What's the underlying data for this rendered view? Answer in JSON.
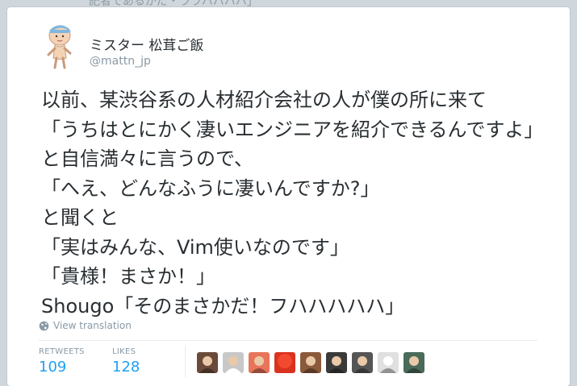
{
  "background": {
    "snippet": "記者であるがだ・ララハハハハ」"
  },
  "tweet": {
    "author": {
      "display_name": "ミスター 松茸ご飯",
      "username": "@mattn_jp"
    },
    "text_lines": [
      "以前、某渋谷系の人材紹介会社の人が僕の所に来て",
      "「うちはとにかく凄いエンジニアを紹介できるんですよ」",
      "と自信満々に言うので、",
      "「へえ、どんなふうに凄いんですか?」",
      "と聞くと",
      "「実はみんな、Vim使いなのです」",
      "「貴様！まさか！」",
      "Shougo「そのまさかだ！フハハハハハ」"
    ],
    "translate_label": "View translation",
    "stats": {
      "retweets_label": "RETWEETS",
      "retweets_value": "109",
      "likes_label": "LIKES",
      "likes_value": "128"
    },
    "liker_avatars": [
      {
        "icon": "liker-avatar-1",
        "color": "#6b4a3a"
      },
      {
        "icon": "liker-avatar-2",
        "color": "#c8c8c8"
      },
      {
        "icon": "liker-avatar-3",
        "color": "#e8745a"
      },
      {
        "icon": "liker-avatar-4",
        "color": "#d9331f"
      },
      {
        "icon": "liker-avatar-5",
        "color": "#8a5a3a"
      },
      {
        "icon": "liker-avatar-6",
        "color": "#3a3a3a"
      },
      {
        "icon": "liker-avatar-7",
        "color": "#555555"
      },
      {
        "icon": "liker-avatar-8",
        "color": "#e0e0e0"
      },
      {
        "icon": "liker-avatar-9",
        "color": "#4a6a5a"
      }
    ]
  }
}
